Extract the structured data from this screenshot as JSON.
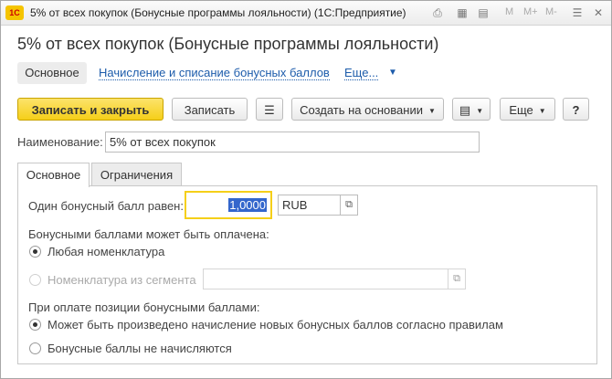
{
  "window": {
    "logo": "1С",
    "title": "5% от всех покупок (Бонусные программы лояльности)  (1С:Предприятие)",
    "tools": {
      "m": "M",
      "mplus": "M+",
      "mminus": "M-"
    }
  },
  "heading": "5% от всех покупок (Бонусные программы лояльности)",
  "nav": {
    "main": "Основное",
    "accrual": "Начисление и списание бонусных баллов",
    "more": "Еще..."
  },
  "toolbar": {
    "save_close": "Записать и закрыть",
    "save": "Записать",
    "create_based": "Создать на основании",
    "more": "Еще",
    "help": "?"
  },
  "form": {
    "name_label": "Наименование:",
    "name_value": "5% от всех покупок",
    "tabs": [
      "Основное",
      "Ограничения"
    ],
    "bonus_label": "Один бонусный балл равен:",
    "bonus_value": "1,0000",
    "currency": "RUB",
    "pay_label": "Бонусными баллами может быть оплачена:",
    "pay_any": "Любая номенклатура",
    "pay_segment": "Номенклатура из сегмента",
    "accrue_label": "При оплате позиции бонусными баллами:",
    "accrue_yes": "Может быть произведено начисление новых бонусных баллов согласно правилам",
    "accrue_no": "Бонусные баллы не начисляются"
  }
}
